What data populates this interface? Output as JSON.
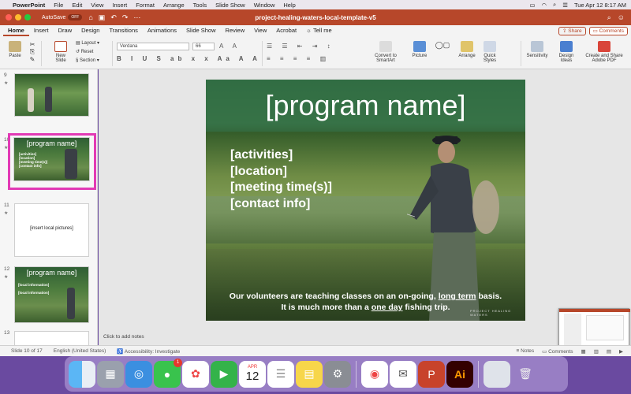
{
  "menubar": {
    "app": "PowerPoint",
    "items": [
      "File",
      "Edit",
      "View",
      "Insert",
      "Format",
      "Arrange",
      "Tools",
      "Slide Show",
      "Window",
      "Help"
    ],
    "datetime": "Tue Apr 12  8:17 AM"
  },
  "titlebar": {
    "autosave_label": "AutoSave",
    "autosave_state": "OFF",
    "doc_title": "project-healing-waters-local-template-v5"
  },
  "ribbon": {
    "tabs": [
      "Home",
      "Insert",
      "Draw",
      "Design",
      "Transitions",
      "Animations",
      "Slide Show",
      "Review",
      "View",
      "Acrobat"
    ],
    "tell_me": "Tell me",
    "share": "Share",
    "comments": "Comments",
    "paste": "Paste",
    "new_slide": "New Slide",
    "layout": "Layout",
    "reset": "Reset",
    "section": "Section",
    "font_name": "Verdana",
    "font_size": "66",
    "convert_smartart": "Convert to SmartArt",
    "picture": "Picture",
    "arrange": "Arrange",
    "quick_styles": "Quick Styles",
    "sensitivity": "Sensitivity",
    "design_ideas": "Design Ideas",
    "create_pdf": "Create and Share Adobe PDF"
  },
  "thumbnails": [
    {
      "num": "9",
      "kind": "photo"
    },
    {
      "num": "10",
      "kind": "template",
      "title": "[program name]",
      "lines": [
        "[activities]",
        "[location]",
        "[meeting time(s)]",
        "[contact info]"
      ]
    },
    {
      "num": "11",
      "kind": "blank",
      "text": "[insert local pictures]"
    },
    {
      "num": "12",
      "kind": "template2",
      "title": "[program name]",
      "lines": [
        "[local information]",
        "[local information]"
      ]
    },
    {
      "num": "13",
      "kind": "blank"
    }
  ],
  "slide": {
    "title": "[program name]",
    "lines": [
      "[activities]",
      "[location]",
      "[meeting time(s)]",
      "[contact info]"
    ],
    "footer_1a": "Our volunteers are teaching classes on an on-going, ",
    "footer_1b": "long term",
    "footer_1c": " basis.",
    "footer_2a": "It is much more than a ",
    "footer_2b": "one day",
    "footer_2c": " fishing trip.",
    "logo": "PROJECT HEALING WATERS"
  },
  "notes_placeholder": "Click to add notes",
  "status": {
    "slide_counter": "Slide 10 of 17",
    "language": "English (United States)",
    "accessibility": "Accessibility: Investigate",
    "notes": "Notes",
    "comments": "Comments"
  },
  "dock": {
    "messages_badge": "1",
    "calendar_month": "APR",
    "calendar_day": "12"
  }
}
